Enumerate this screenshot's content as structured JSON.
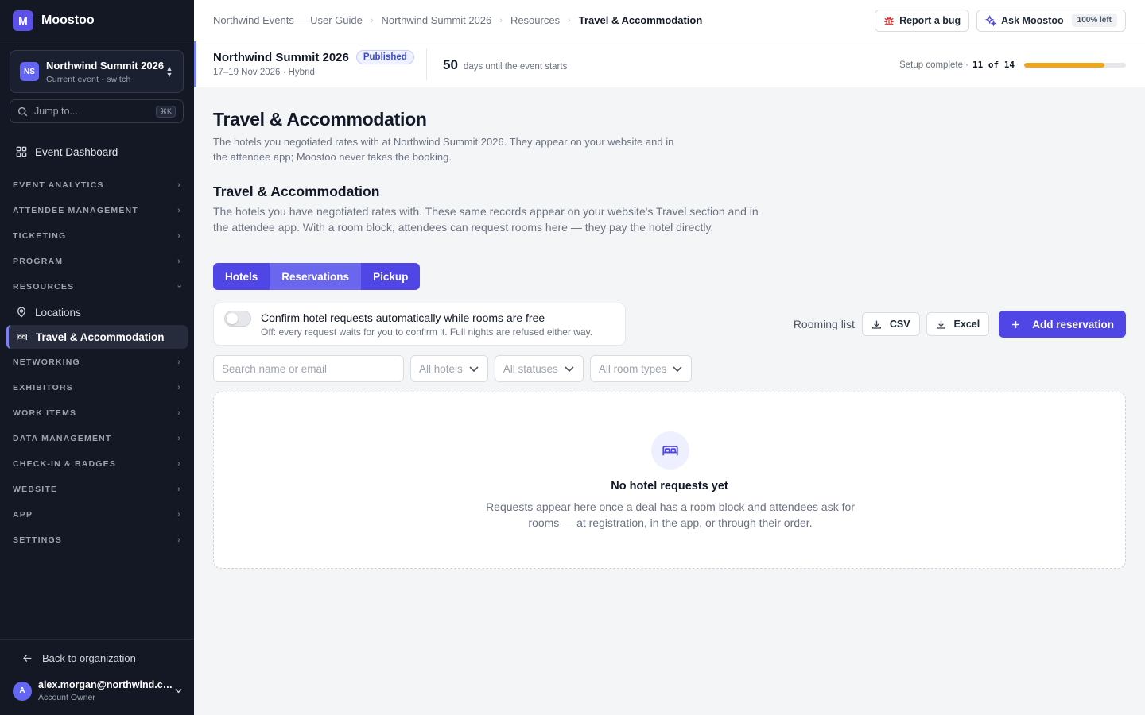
{
  "app": {
    "logo_letter": "M",
    "name": "Moostoo"
  },
  "event_switcher": {
    "badge": "NS",
    "name": "Northwind Summit 2026",
    "subtitle": "Current event · switch"
  },
  "jump": {
    "placeholder": "Jump to...",
    "shortcut": "⌘K"
  },
  "nav": {
    "dashboard": "Event Dashboard",
    "sections": {
      "event_analytics": "EVENT ANALYTICS",
      "attendee_management": "ATTENDEE MANAGEMENT",
      "ticketing": "TICKETING",
      "program": "PROGRAM",
      "resources": "RESOURCES",
      "networking": "NETWORKING",
      "exhibitors": "EXHIBITORS",
      "work_items": "WORK ITEMS",
      "data_management": "DATA MANAGEMENT",
      "checkin_badges": "CHECK-IN & BADGES",
      "website": "WEBSITE",
      "app": "APP",
      "settings": "SETTINGS"
    },
    "resources_items": {
      "locations": "Locations",
      "travel": "Travel & Accommodation"
    }
  },
  "footer": {
    "back_label": "Back to organization",
    "user_initial": "A",
    "user_email": "alex.morgan@northwind.com",
    "user_role": "Account Owner"
  },
  "breadcrumb": [
    "Northwind Events — User Guide",
    "Northwind Summit 2026",
    "Resources",
    "Travel & Accommodation"
  ],
  "topbar": {
    "report_bug": "Report a bug",
    "ask": "Ask Moostoo",
    "ask_quota": "100% left"
  },
  "event_strip": {
    "name": "Northwind Summit 2026",
    "status": "Published",
    "dates": "17–19 Nov 2026 · Hybrid",
    "days": "50",
    "days_label": "days until the event starts",
    "setup_label": "Setup complete ·",
    "setup_value": "11 of 14",
    "setup_fraction": 0.786
  },
  "page": {
    "title": "Travel & Accommodation",
    "intro": "The hotels you negotiated rates with at Northwind Summit 2026. They appear on your website and in the attendee app; Moostoo never takes the booking.",
    "section_title": "Travel & Accommodation",
    "section_desc": "The hotels you have negotiated rates with. These same records appear on your website's Travel section and in the attendee app. With a room block, attendees can request rooms here — they pay the hotel directly."
  },
  "tabs": {
    "hotels": "Hotels",
    "reservations": "Reservations",
    "pickup": "Pickup"
  },
  "auto_confirm": {
    "title": "Confirm hotel requests automatically while rooms are free",
    "subtitle": "Off: every request waits for you to confirm it. Full nights are refused either way."
  },
  "rooming": {
    "label": "Rooming list",
    "csv": "CSV",
    "excel": "Excel",
    "add": "Add reservation"
  },
  "filters": {
    "search_placeholder": "Search name or email",
    "hotels": "All hotels",
    "statuses": "All statuses",
    "room_types": "All room types"
  },
  "empty_state": {
    "title": "No hotel requests yet",
    "text": "Requests appear here once a deal has a room block and attendees ask for rooms — at registration, in the app, or through their order."
  },
  "colors": {
    "accent": "#4f46e5",
    "progress": "#f0a51b",
    "sidebar": "#141824"
  },
  "icons": {
    "search": "search-icon",
    "grid": "grid-icon",
    "pin": "map-pin-icon",
    "bed": "bed-icon",
    "bug": "bug-icon",
    "sparkle": "sparkle-icon",
    "download": "download-icon",
    "plus": "plus-icon"
  }
}
